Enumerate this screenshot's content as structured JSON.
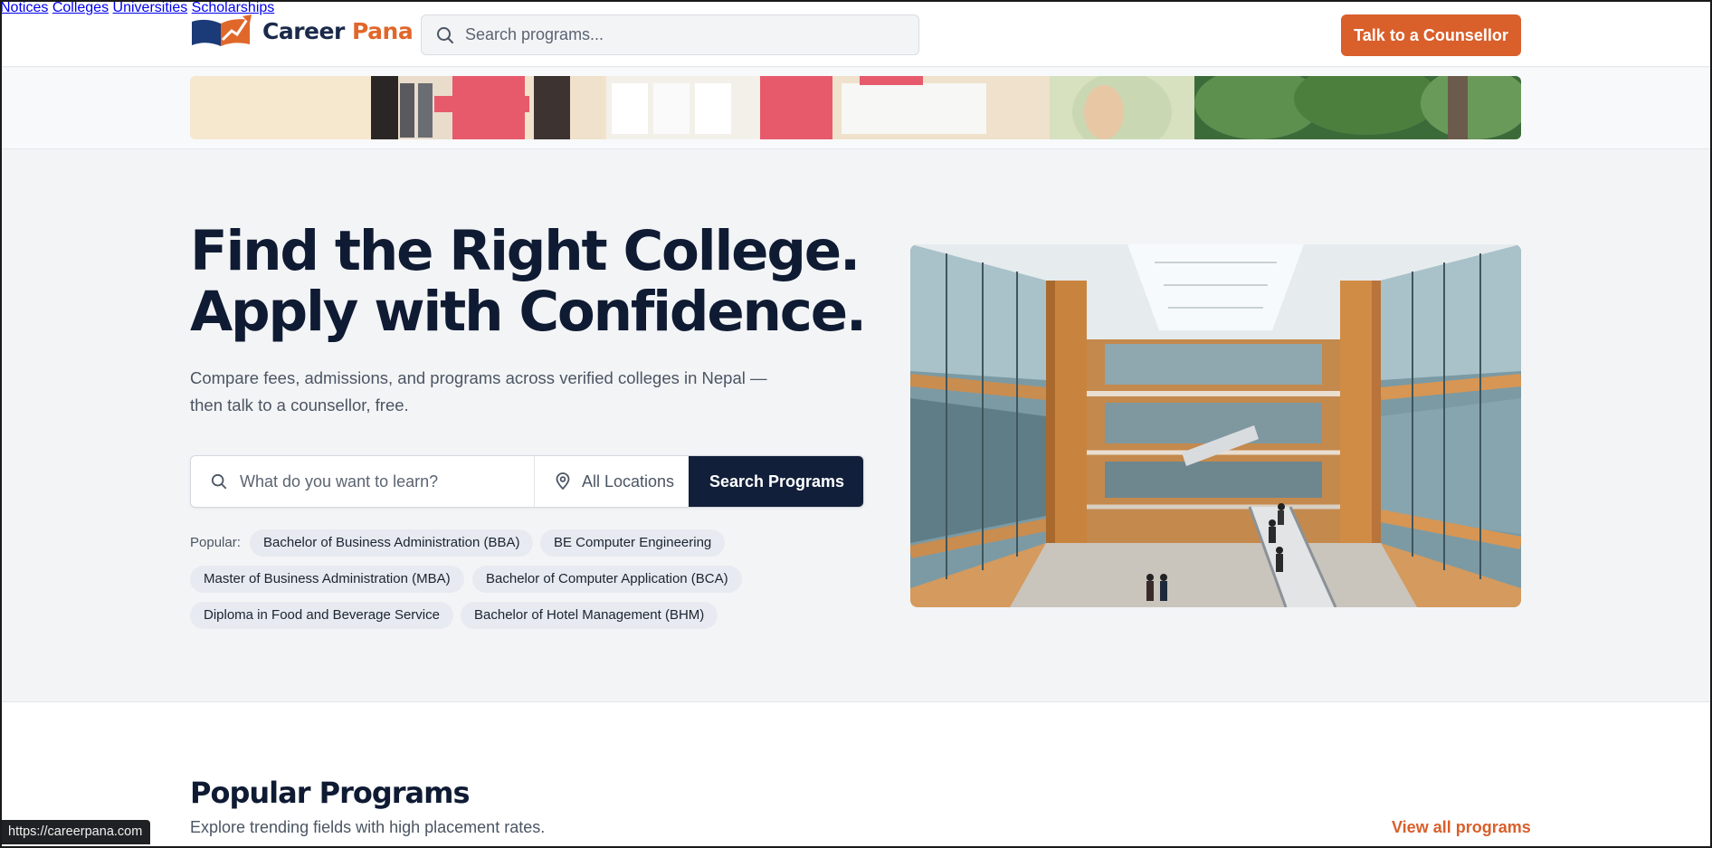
{
  "brand": {
    "name_part1": "Career",
    "name_part2": "Pana",
    "primary_color": "#1b2a4a",
    "accent_color": "#e0672a"
  },
  "header": {
    "search_placeholder": "Search programs...",
    "nav": [
      "Notices",
      "Colleges",
      "Universities",
      "Scholarships"
    ],
    "cta_label": "Talk to a Counsellor"
  },
  "hero": {
    "title_line1": "Find the Right College.",
    "title_line2": "Apply with Confidence.",
    "subtitle": "Compare fees, admissions, and programs across verified colleges in Nepal — then talk to a counsellor, free.",
    "search_placeholder": "What do you want to learn?",
    "location_label": "All Locations",
    "search_button": "Search Programs",
    "popular_label": "Popular:",
    "popular_chips": [
      "Bachelor of Business Administration (BBA)",
      "BE Computer Engineering",
      "Master of Business Administration (MBA)",
      "Bachelor of Computer Application (BCA)",
      "Diploma in Food and Beverage Service",
      "Bachelor of Hotel Management (BHM)"
    ]
  },
  "popular_programs": {
    "title": "Popular Programs",
    "subtitle": "Explore trending fields with high placement rates.",
    "view_all": "View all programs"
  },
  "status_bar": {
    "url": "https://careerpana.com"
  }
}
